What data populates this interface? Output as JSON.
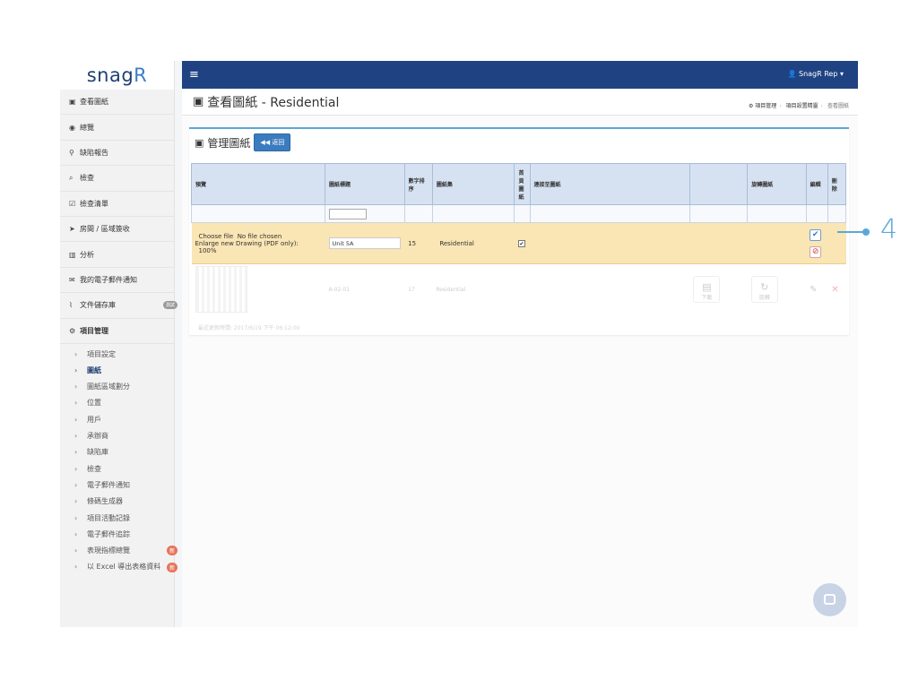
{
  "brand": {
    "logo_text": "snag",
    "logo_mark": "R"
  },
  "sidebar": {
    "items": [
      {
        "label": "查看圖紙",
        "icon": "image-icon"
      },
      {
        "label": "總覽",
        "icon": "dashboard-icon"
      },
      {
        "label": "缺陷報告",
        "icon": "map-marker-icon"
      },
      {
        "label": "檢查",
        "icon": "search-icon"
      },
      {
        "label": "檢查清單",
        "icon": "checkbox-icon"
      },
      {
        "label": "房間 / 區域簽收",
        "icon": "location-arrow-icon"
      },
      {
        "label": "分析",
        "icon": "bar-chart-icon"
      },
      {
        "label": "我的電子郵件通知",
        "icon": "envelope-icon"
      },
      {
        "label": "文件儲存庫",
        "icon": "paperclip-icon",
        "badge": "測試"
      },
      {
        "label": "項目管理",
        "icon": "cogs-icon"
      }
    ],
    "subitems": [
      {
        "label": "項目設定"
      },
      {
        "label": "圖紙",
        "current": true
      },
      {
        "label": "圖紙區域劃分"
      },
      {
        "label": "位置"
      },
      {
        "label": "用戶"
      },
      {
        "label": "承辦商"
      },
      {
        "label": "缺陷庫"
      },
      {
        "label": "檢查"
      },
      {
        "label": "電子郵件通知"
      },
      {
        "label": "條碼生成器"
      },
      {
        "label": "項目活動記錄"
      },
      {
        "label": "電子郵件追踪"
      },
      {
        "label": "表現指標總覽",
        "badge": "新"
      },
      {
        "label": "以 Excel 導出表格資料",
        "badge": "新"
      }
    ]
  },
  "topbar": {
    "user": "SnagR Rep"
  },
  "page": {
    "title": "查看圖紙 - Residential",
    "breadcrumb": [
      "項目管理",
      "項目設置精靈",
      "查看圖紙"
    ]
  },
  "panel": {
    "title": "管理圖紙",
    "back_label": "返回"
  },
  "table": {
    "headers": [
      "預覽",
      "圖紙標題",
      "數字排序",
      "圖紙集",
      "首頁圖紙",
      "連接至圖紙",
      "",
      "旋轉圖紙",
      "編輯",
      "刪除"
    ],
    "edit_row": {
      "file_button": "Choose file",
      "file_status": "No file chosen",
      "enlarge_label": "Enlarge new Drawing (PDF only):",
      "enlarge_value": "100%",
      "title_value": "Unit 5A",
      "order": "15",
      "set": "Residential"
    },
    "data_row": {
      "title": "A-02-01",
      "order": "17",
      "set": "Residential",
      "download_label": "下載",
      "rotate_label": "旋轉",
      "updated": "最近更新時間: 2017/6/19 下午 06:12:00"
    }
  },
  "callout": {
    "number": "4"
  },
  "colors": {
    "brand": "#1f4282",
    "accent": "#5aa8d8",
    "edit_row": "#fae5b4"
  }
}
